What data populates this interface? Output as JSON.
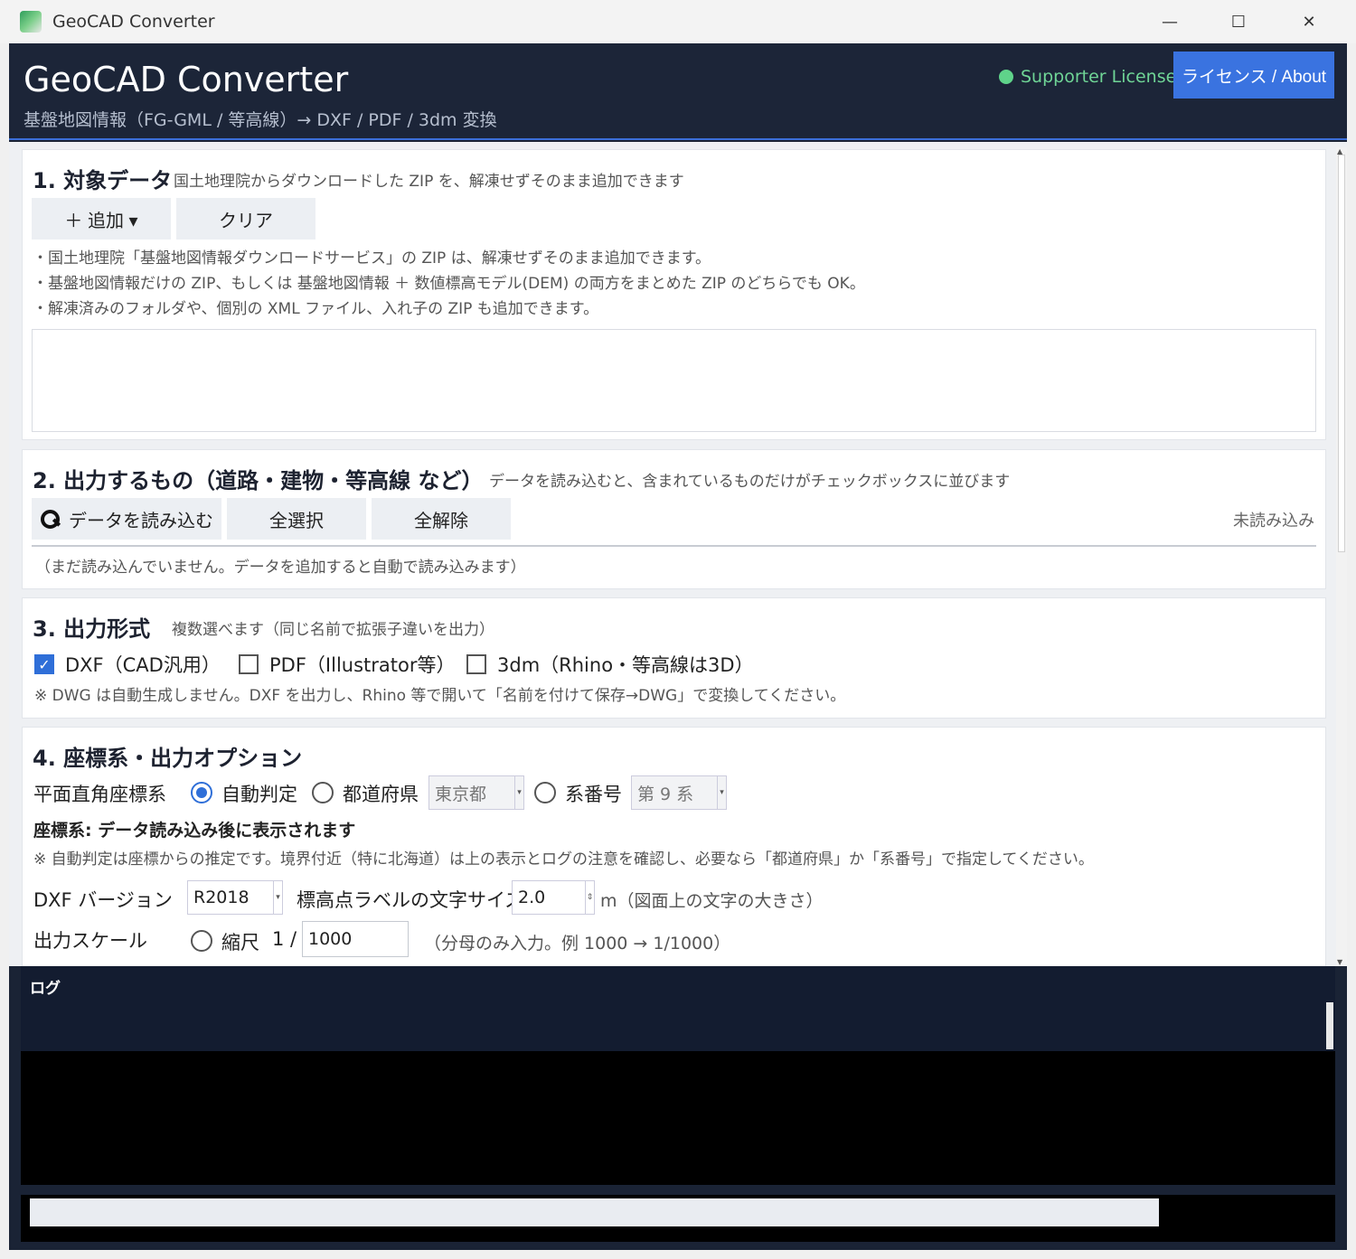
{
  "window": {
    "title": "GeoCAD Converter",
    "minimize": "—",
    "maximize": "☐",
    "close": "✕"
  },
  "header": {
    "title": "GeoCAD Converter",
    "subtitle": "基盤地図情報（FG-GML / 等高線）→ DXF / PDF / 3dm 変換",
    "license_status": "Supporter License",
    "license_status_color": "#6fd596",
    "license_button": "ライセンス / About",
    "accent_color": "#3a73e0"
  },
  "section1": {
    "title": "1.  対象データ",
    "desc": "国土地理院からダウンロードした ZIP を、解凍せずそのまま追加できます",
    "add_button": "＋  追加  ▾",
    "clear_button": "クリア",
    "notes": [
      "・国土地理院「基盤地図情報ダウンロードサービス」の ZIP は、解凍せずそのまま追加できます。",
      "・基盤地図情報だけの ZIP、もしくは 基盤地図情報 ＋ 数値標高モデル(DEM) の両方をまとめた ZIP のどちらでも OK。",
      "・解凍済みのフォルダや、個別の XML ファイル、入れ子の ZIP も追加できます。"
    ]
  },
  "section2": {
    "title": "2.  出力するもの（道路・建物・等高線 など）",
    "desc": "データを読み込むと、含まれているものだけがチェックボックスに並びます",
    "load_button": "データを読み込む",
    "select_all_button": "全選択",
    "deselect_all_button": "全解除",
    "status": "未読み込み",
    "empty_message": "（まだ読み込んでいません。データを追加すると自動で読み込みます）"
  },
  "section3": {
    "title": "3.  出力形式",
    "desc": "複数選べます（同じ名前で拡張子違いを出力）",
    "options": [
      {
        "label": "DXF（CAD汎用）",
        "checked": true
      },
      {
        "label": "PDF（Illustrator等）",
        "checked": false
      },
      {
        "label": "3dm（Rhino・等高線は3D）",
        "checked": false
      }
    ],
    "note": "※ DWG は自動生成しません。DXF を出力し、Rhino 等で開いて「名前を付けて保存→DWG」で変換してください。"
  },
  "section4": {
    "title": "4.  座標系・出力オプション",
    "crs_label": "平面直角座標系",
    "auto_label": "自動判定",
    "pref_label": "都道府県",
    "pref_value": "東京都",
    "zone_label": "系番号",
    "zone_value": "第 9 系",
    "crs_status": "座標系: データ読み込み後に表示されます",
    "crs_note": "※ 自動判定は座標からの推定です。境界付近（特に北海道）は上の表示とログの注意を確認し、必要なら「都道府県」か「系番号」で指定してください。",
    "dxf_label": "DXF バージョン",
    "dxf_value": "R2018",
    "label_size_label": "標高点ラベルの文字サイズ",
    "label_size_value": "2.0",
    "label_size_unit": "m（図面上の文字の大きさ）",
    "scale_label": "出力スケール",
    "scale_radio_label": "縮尺",
    "scale_prefix": "1 /",
    "scale_value": "1000",
    "scale_hint": "（分母のみ入力。例 1000 → 1/1000）"
  },
  "log": {
    "title": "ログ"
  },
  "progress": {
    "value": 0
  }
}
